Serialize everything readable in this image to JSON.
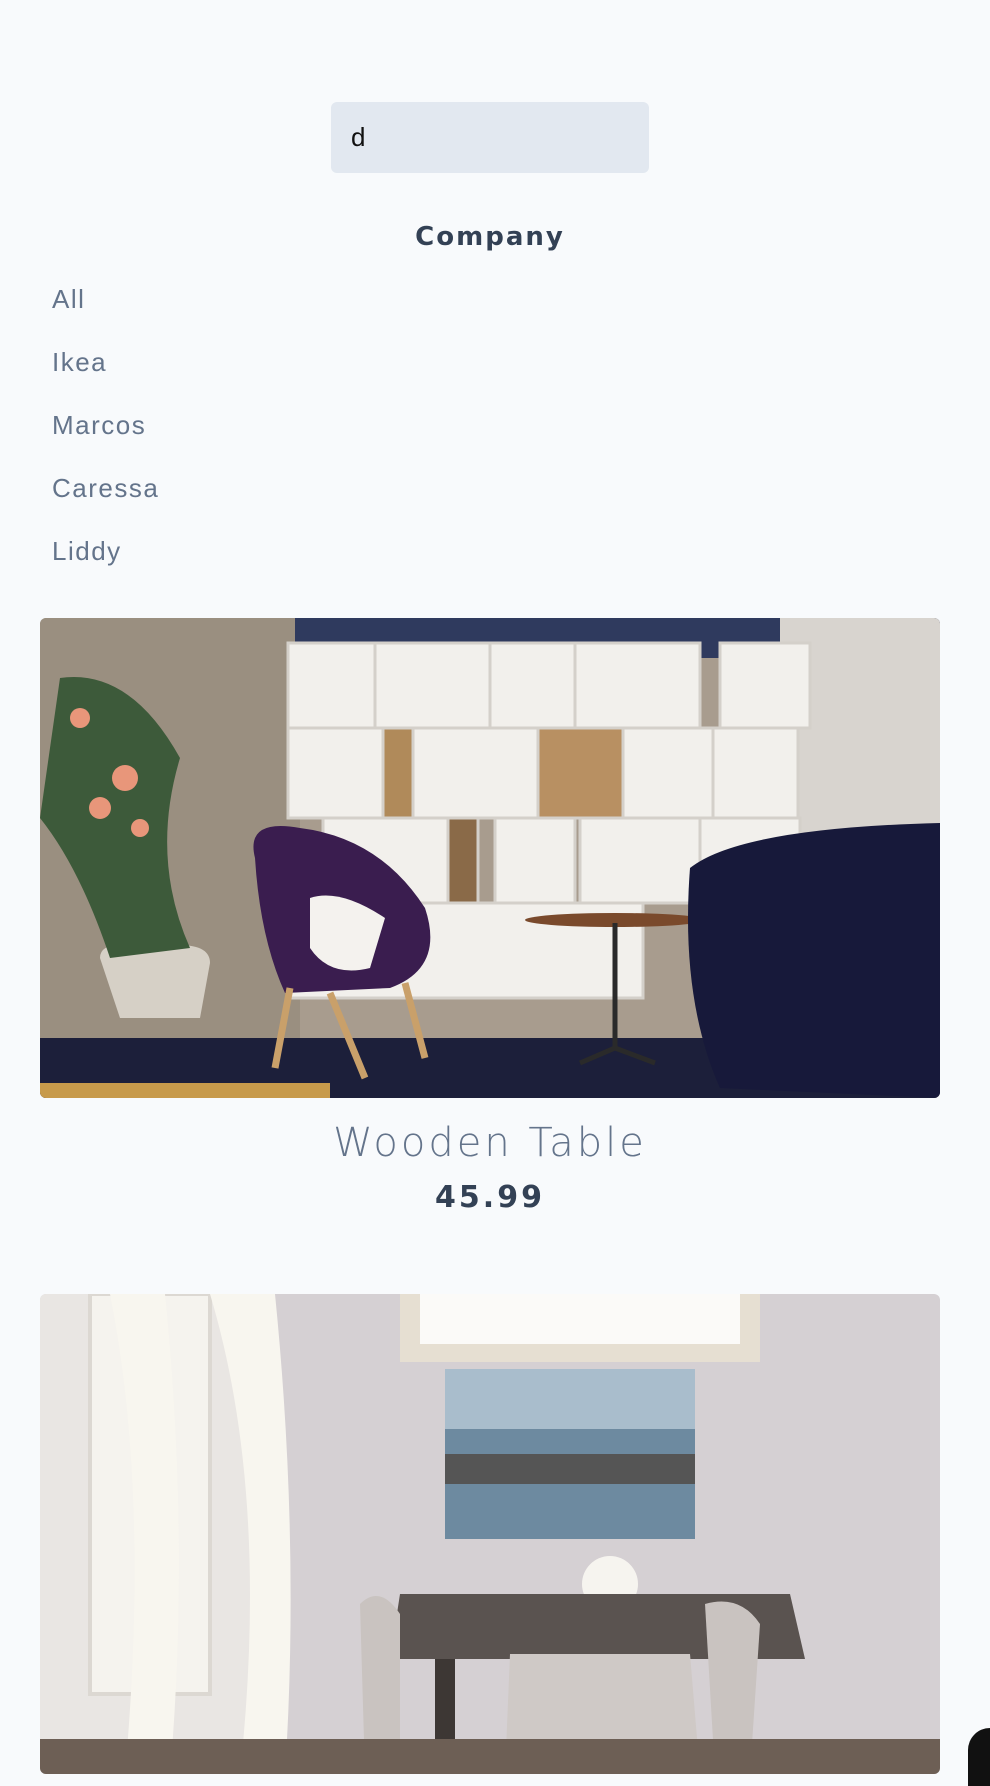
{
  "search": {
    "value": "d"
  },
  "filters": {
    "heading": "Company",
    "companies": [
      {
        "label": "All"
      },
      {
        "label": "Ikea"
      },
      {
        "label": "Marcos"
      },
      {
        "label": "Caressa"
      },
      {
        "label": "Liddy"
      }
    ]
  },
  "products": [
    {
      "name": "Wooden Table",
      "price": "45.99"
    }
  ],
  "colors": {
    "page_background": "#f8fafc",
    "input_background": "#e2e8f0",
    "heading_text": "#334155",
    "muted_text": "#64748b"
  }
}
